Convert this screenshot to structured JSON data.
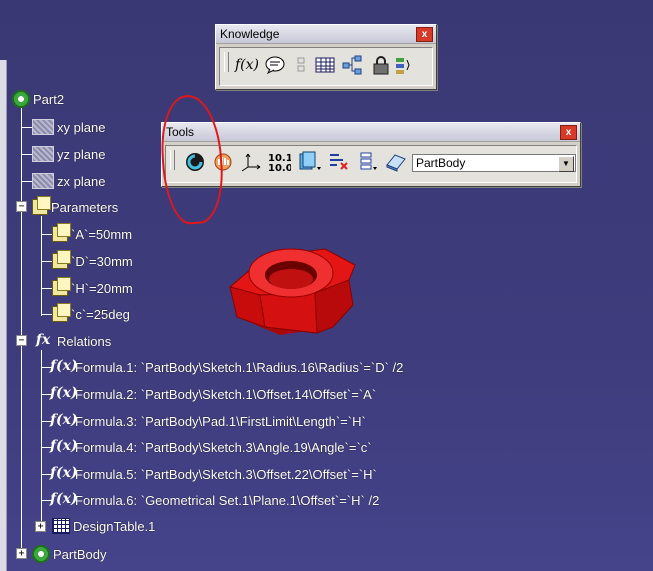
{
  "tree": {
    "root": "Part2",
    "planes": [
      "xy plane",
      "yz plane",
      "zx plane"
    ],
    "parameters_label": "Parameters",
    "parameters": [
      "`A`=50mm",
      "`D`=30mm",
      "`H`=20mm",
      "`c`=25deg"
    ],
    "relations_label": "Relations",
    "formulas": [
      "Formula.1: `PartBody\\Sketch.1\\Radius.16\\Radius`=`D` /2",
      "Formula.2: `PartBody\\Sketch.1\\Offset.14\\Offset`=`A`",
      "Formula.3: `PartBody\\Pad.1\\FirstLimit\\Length`=`H`",
      "Formula.4: `PartBody\\Sketch.3\\Angle.19\\Angle`=`c`",
      "Formula.5: `PartBody\\Sketch.3\\Offset.22\\Offset`=`H`",
      "Formula.6: `Geometrical Set.1\\Plane.1\\Offset`=`H` /2"
    ],
    "design_table": "DesignTable.1",
    "partbody": "PartBody"
  },
  "knowledge_toolbar": {
    "title": "Knowledge",
    "close_label": "x",
    "buttons": [
      "formula-icon",
      "comment-icon",
      "check-icon",
      "design-table-icon",
      "relations-icon",
      "lock-icon",
      "rules-icon"
    ]
  },
  "tools_toolbar": {
    "title": "Tools",
    "close_label": "x",
    "buttons": [
      "update-icon",
      "manual-update-icon",
      "axis-system-icon",
      "units-icon",
      "work-object-icon",
      "scan-icon",
      "list-icon",
      "selection-icon"
    ],
    "body_select": "PartBody"
  },
  "colors": {
    "background": "#3c3a78",
    "annotation": "#e01818",
    "nut": "#e41010"
  }
}
